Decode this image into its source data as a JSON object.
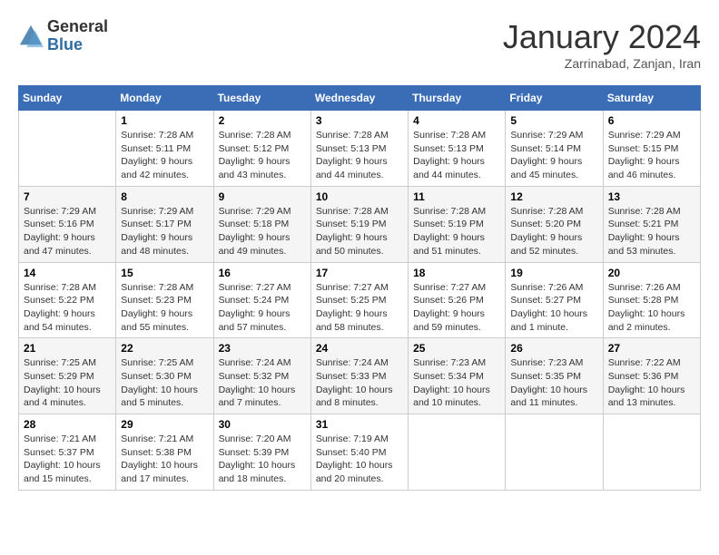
{
  "header": {
    "logo_general": "General",
    "logo_blue": "Blue",
    "month_title": "January 2024",
    "location": "Zarrinabad, Zanjan, Iran"
  },
  "days_of_week": [
    "Sunday",
    "Monday",
    "Tuesday",
    "Wednesday",
    "Thursday",
    "Friday",
    "Saturday"
  ],
  "weeks": [
    {
      "days": [
        {
          "number": "",
          "sunrise": "",
          "sunset": "",
          "daylight": ""
        },
        {
          "number": "1",
          "sunrise": "Sunrise: 7:28 AM",
          "sunset": "Sunset: 5:11 PM",
          "daylight": "Daylight: 9 hours and 42 minutes."
        },
        {
          "number": "2",
          "sunrise": "Sunrise: 7:28 AM",
          "sunset": "Sunset: 5:12 PM",
          "daylight": "Daylight: 9 hours and 43 minutes."
        },
        {
          "number": "3",
          "sunrise": "Sunrise: 7:28 AM",
          "sunset": "Sunset: 5:13 PM",
          "daylight": "Daylight: 9 hours and 44 minutes."
        },
        {
          "number": "4",
          "sunrise": "Sunrise: 7:28 AM",
          "sunset": "Sunset: 5:13 PM",
          "daylight": "Daylight: 9 hours and 44 minutes."
        },
        {
          "number": "5",
          "sunrise": "Sunrise: 7:29 AM",
          "sunset": "Sunset: 5:14 PM",
          "daylight": "Daylight: 9 hours and 45 minutes."
        },
        {
          "number": "6",
          "sunrise": "Sunrise: 7:29 AM",
          "sunset": "Sunset: 5:15 PM",
          "daylight": "Daylight: 9 hours and 46 minutes."
        }
      ]
    },
    {
      "days": [
        {
          "number": "7",
          "sunrise": "Sunrise: 7:29 AM",
          "sunset": "Sunset: 5:16 PM",
          "daylight": "Daylight: 9 hours and 47 minutes."
        },
        {
          "number": "8",
          "sunrise": "Sunrise: 7:29 AM",
          "sunset": "Sunset: 5:17 PM",
          "daylight": "Daylight: 9 hours and 48 minutes."
        },
        {
          "number": "9",
          "sunrise": "Sunrise: 7:29 AM",
          "sunset": "Sunset: 5:18 PM",
          "daylight": "Daylight: 9 hours and 49 minutes."
        },
        {
          "number": "10",
          "sunrise": "Sunrise: 7:28 AM",
          "sunset": "Sunset: 5:19 PM",
          "daylight": "Daylight: 9 hours and 50 minutes."
        },
        {
          "number": "11",
          "sunrise": "Sunrise: 7:28 AM",
          "sunset": "Sunset: 5:19 PM",
          "daylight": "Daylight: 9 hours and 51 minutes."
        },
        {
          "number": "12",
          "sunrise": "Sunrise: 7:28 AM",
          "sunset": "Sunset: 5:20 PM",
          "daylight": "Daylight: 9 hours and 52 minutes."
        },
        {
          "number": "13",
          "sunrise": "Sunrise: 7:28 AM",
          "sunset": "Sunset: 5:21 PM",
          "daylight": "Daylight: 9 hours and 53 minutes."
        }
      ]
    },
    {
      "days": [
        {
          "number": "14",
          "sunrise": "Sunrise: 7:28 AM",
          "sunset": "Sunset: 5:22 PM",
          "daylight": "Daylight: 9 hours and 54 minutes."
        },
        {
          "number": "15",
          "sunrise": "Sunrise: 7:28 AM",
          "sunset": "Sunset: 5:23 PM",
          "daylight": "Daylight: 9 hours and 55 minutes."
        },
        {
          "number": "16",
          "sunrise": "Sunrise: 7:27 AM",
          "sunset": "Sunset: 5:24 PM",
          "daylight": "Daylight: 9 hours and 57 minutes."
        },
        {
          "number": "17",
          "sunrise": "Sunrise: 7:27 AM",
          "sunset": "Sunset: 5:25 PM",
          "daylight": "Daylight: 9 hours and 58 minutes."
        },
        {
          "number": "18",
          "sunrise": "Sunrise: 7:27 AM",
          "sunset": "Sunset: 5:26 PM",
          "daylight": "Daylight: 9 hours and 59 minutes."
        },
        {
          "number": "19",
          "sunrise": "Sunrise: 7:26 AM",
          "sunset": "Sunset: 5:27 PM",
          "daylight": "Daylight: 10 hours and 1 minute."
        },
        {
          "number": "20",
          "sunrise": "Sunrise: 7:26 AM",
          "sunset": "Sunset: 5:28 PM",
          "daylight": "Daylight: 10 hours and 2 minutes."
        }
      ]
    },
    {
      "days": [
        {
          "number": "21",
          "sunrise": "Sunrise: 7:25 AM",
          "sunset": "Sunset: 5:29 PM",
          "daylight": "Daylight: 10 hours and 4 minutes."
        },
        {
          "number": "22",
          "sunrise": "Sunrise: 7:25 AM",
          "sunset": "Sunset: 5:30 PM",
          "daylight": "Daylight: 10 hours and 5 minutes."
        },
        {
          "number": "23",
          "sunrise": "Sunrise: 7:24 AM",
          "sunset": "Sunset: 5:32 PM",
          "daylight": "Daylight: 10 hours and 7 minutes."
        },
        {
          "number": "24",
          "sunrise": "Sunrise: 7:24 AM",
          "sunset": "Sunset: 5:33 PM",
          "daylight": "Daylight: 10 hours and 8 minutes."
        },
        {
          "number": "25",
          "sunrise": "Sunrise: 7:23 AM",
          "sunset": "Sunset: 5:34 PM",
          "daylight": "Daylight: 10 hours and 10 minutes."
        },
        {
          "number": "26",
          "sunrise": "Sunrise: 7:23 AM",
          "sunset": "Sunset: 5:35 PM",
          "daylight": "Daylight: 10 hours and 11 minutes."
        },
        {
          "number": "27",
          "sunrise": "Sunrise: 7:22 AM",
          "sunset": "Sunset: 5:36 PM",
          "daylight": "Daylight: 10 hours and 13 minutes."
        }
      ]
    },
    {
      "days": [
        {
          "number": "28",
          "sunrise": "Sunrise: 7:21 AM",
          "sunset": "Sunset: 5:37 PM",
          "daylight": "Daylight: 10 hours and 15 minutes."
        },
        {
          "number": "29",
          "sunrise": "Sunrise: 7:21 AM",
          "sunset": "Sunset: 5:38 PM",
          "daylight": "Daylight: 10 hours and 17 minutes."
        },
        {
          "number": "30",
          "sunrise": "Sunrise: 7:20 AM",
          "sunset": "Sunset: 5:39 PM",
          "daylight": "Daylight: 10 hours and 18 minutes."
        },
        {
          "number": "31",
          "sunrise": "Sunrise: 7:19 AM",
          "sunset": "Sunset: 5:40 PM",
          "daylight": "Daylight: 10 hours and 20 minutes."
        },
        {
          "number": "",
          "sunrise": "",
          "sunset": "",
          "daylight": ""
        },
        {
          "number": "",
          "sunrise": "",
          "sunset": "",
          "daylight": ""
        },
        {
          "number": "",
          "sunrise": "",
          "sunset": "",
          "daylight": ""
        }
      ]
    }
  ]
}
